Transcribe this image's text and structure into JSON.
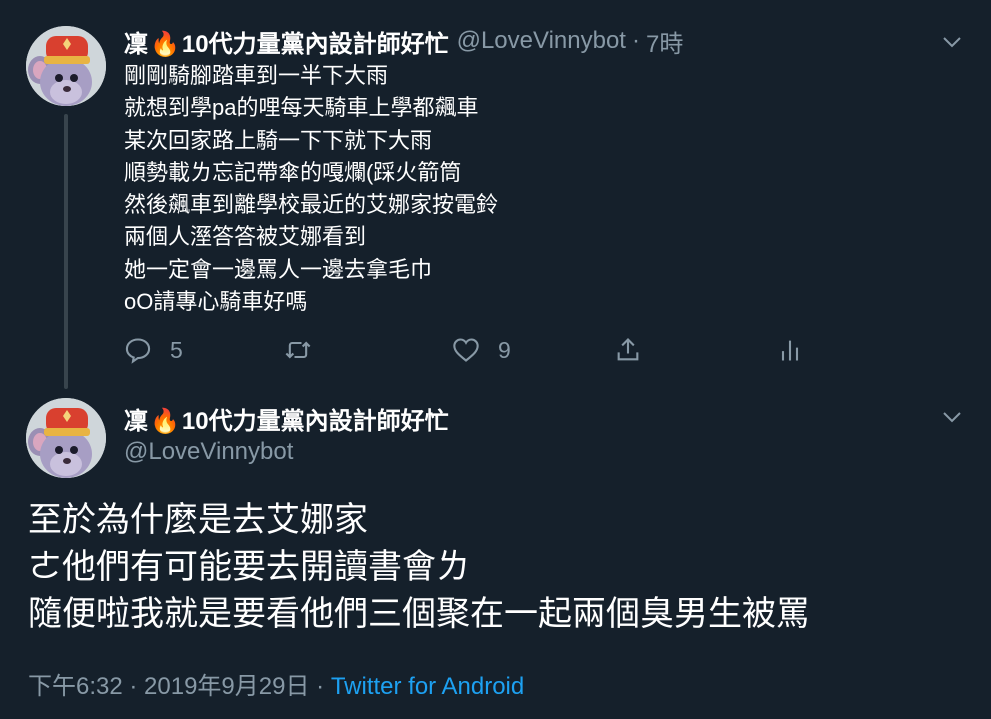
{
  "tweet1": {
    "display_name": "凜",
    "display_name_rest": "10代力量黨內設計師好忙",
    "fire_glyph": "🔥",
    "handle": "@LoveVinnybot",
    "separator": "·",
    "time": "7時",
    "lines": [
      "剛剛騎腳踏車到一半下大雨",
      "就想到學pa的哩每天騎車上學都飆車",
      "某次回家路上騎一下下就下大雨",
      "順勢載ㄌ忘記帶傘的嘎爛(踩火箭筒",
      "然後飆車到離學校最近的艾娜家按電鈴",
      "兩個人溼答答被艾娜看到",
      "她一定會一邊罵人一邊去拿毛巾",
      "oO請專心騎車好嗎"
    ],
    "actions": {
      "reply_count": "5",
      "retweet_count": "",
      "like_count": "9"
    }
  },
  "tweet2": {
    "display_name": "凜",
    "display_name_rest": "10代力量黨內設計師好忙",
    "fire_glyph": "🔥",
    "handle": "@LoveVinnybot",
    "lines": [
      "至於為什麼是去艾娜家",
      "ㄜ他們有可能要去開讀書會ㄌ",
      "隨便啦我就是要看他們三個聚在一起兩個臭男生被罵"
    ],
    "meta_time": "下午6:32 · 2019年9月29日 · ",
    "meta_app": "Twitter for Android"
  },
  "icons": {
    "avatar": "rat-chef-avatar",
    "more": "chevron-down-icon",
    "reply": "reply-icon",
    "retweet": "retweet-icon",
    "like": "heart-icon",
    "share": "share-icon",
    "analytics": "analytics-icon"
  },
  "colors": {
    "background": "#15202b",
    "text": "#ffffff",
    "secondary": "#8899a6",
    "link": "#1da1f2",
    "thread_line": "#38444d"
  }
}
